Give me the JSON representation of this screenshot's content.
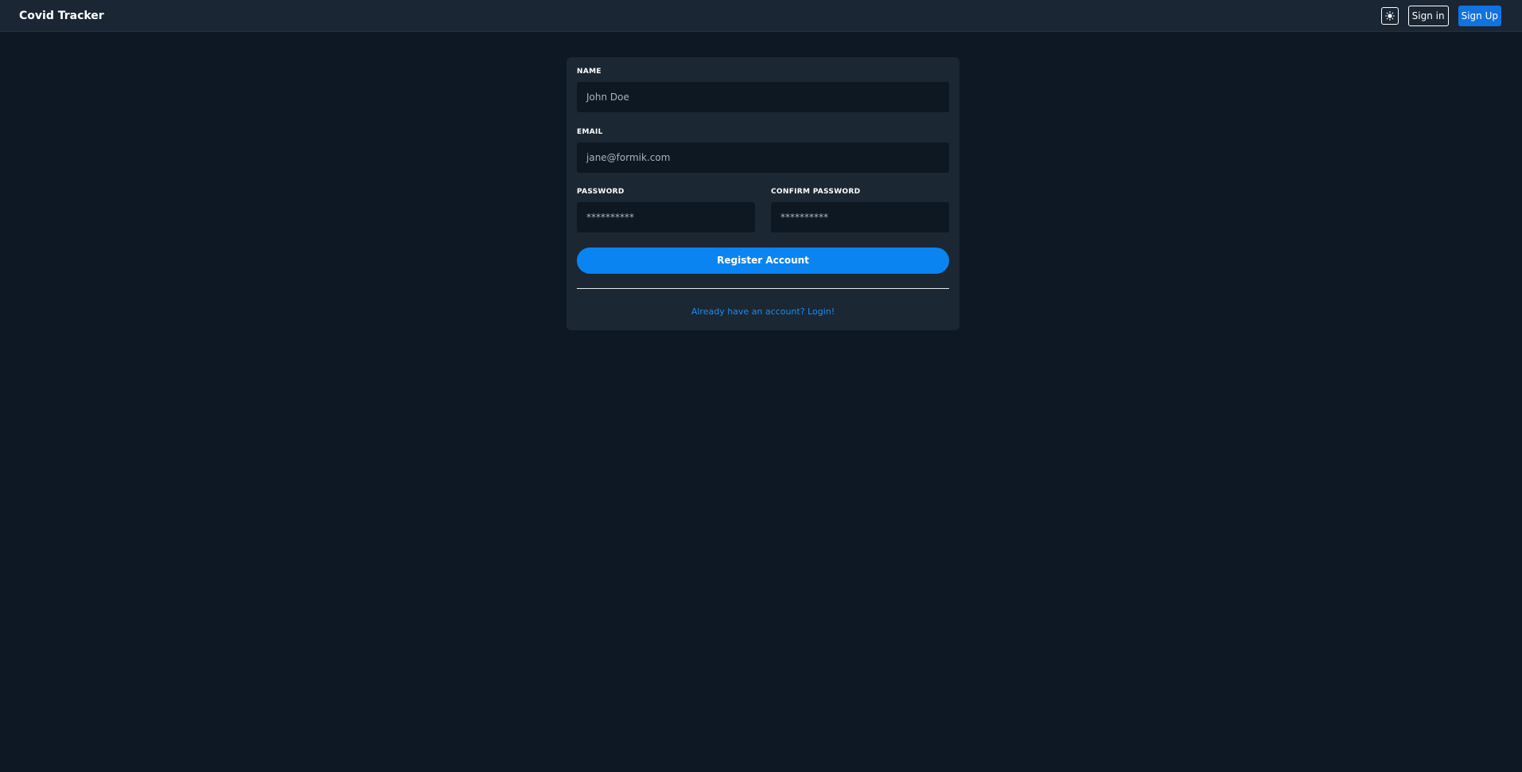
{
  "app": {
    "title": "Covid Tracker"
  },
  "nav": {
    "theme_icon": "sun-icon",
    "signin_label": "Sign in",
    "signup_label": "Sign Up"
  },
  "form": {
    "name_label": "NAME",
    "name_placeholder": "John Doe",
    "email_label": "EMAIL",
    "email_placeholder": "jane@formik.com",
    "password_label": "PASSWORD",
    "password_placeholder": "**********",
    "confirm_label": "CONFIRM PASSWORD",
    "confirm_placeholder": "**********",
    "submit_label": "Register Account",
    "login_link": "Already have an account? Login!"
  },
  "colors": {
    "background": "#0d1824",
    "navbar": "#1a2633",
    "card": "#1b2733",
    "input": "#0e1822",
    "primary": "#0a84f0",
    "signup": "#1172e0",
    "link": "#1b8cf2"
  }
}
